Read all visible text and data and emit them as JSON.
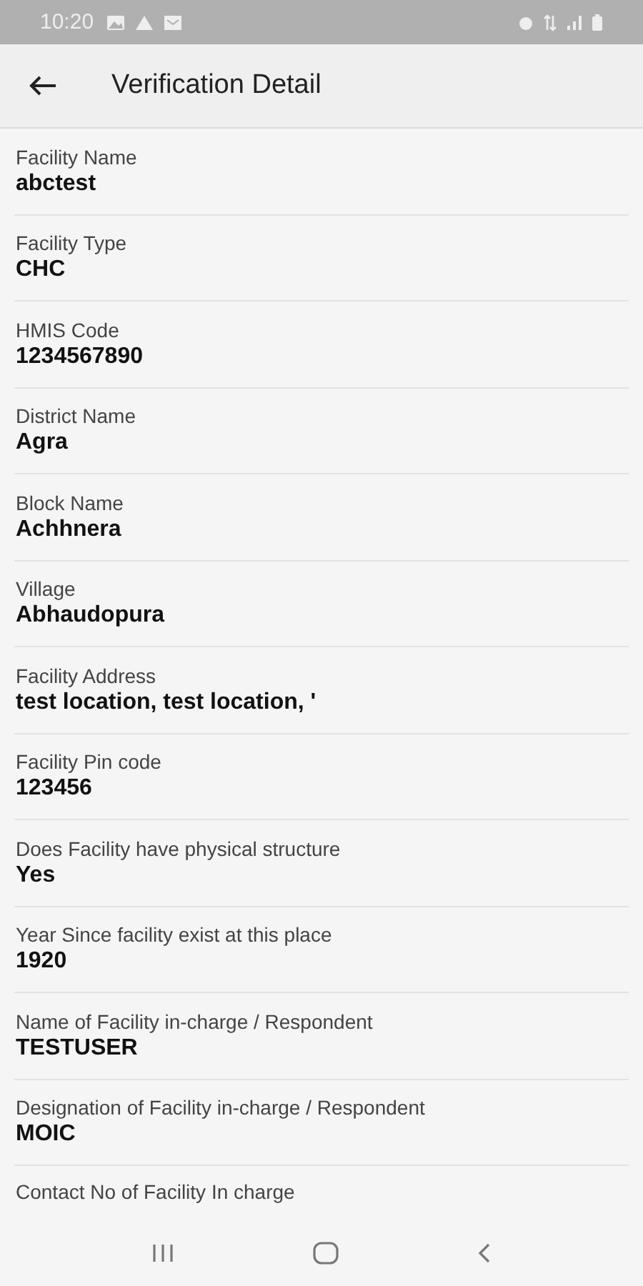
{
  "status_bar": {
    "time": "10:20"
  },
  "app_bar": {
    "title": "Verification Detail"
  },
  "fields": [
    {
      "label": "Facility Name",
      "value": "abctest"
    },
    {
      "label": "Facility Type",
      "value": "CHC"
    },
    {
      "label": "HMIS Code",
      "value": "1234567890"
    },
    {
      "label": "District Name",
      "value": "Agra"
    },
    {
      "label": "Block Name",
      "value": "Achhnera"
    },
    {
      "label": "Village",
      "value": "Abhaudopura"
    },
    {
      "label": "Facility Address",
      "value": "test location, test location, '"
    },
    {
      "label": "Facility Pin code",
      "value": "123456"
    },
    {
      "label": "Does Facility have physical structure",
      "value": "Yes"
    },
    {
      "label": "Year Since facility exist at this place",
      "value": "1920"
    },
    {
      "label": "Name of Facility in-charge / Respondent",
      "value": "TESTUSER"
    },
    {
      "label": "Designation of Facility in-charge / Respondent",
      "value": "MOIC"
    },
    {
      "label": "Contact No of Facility In charge"
    }
  ]
}
